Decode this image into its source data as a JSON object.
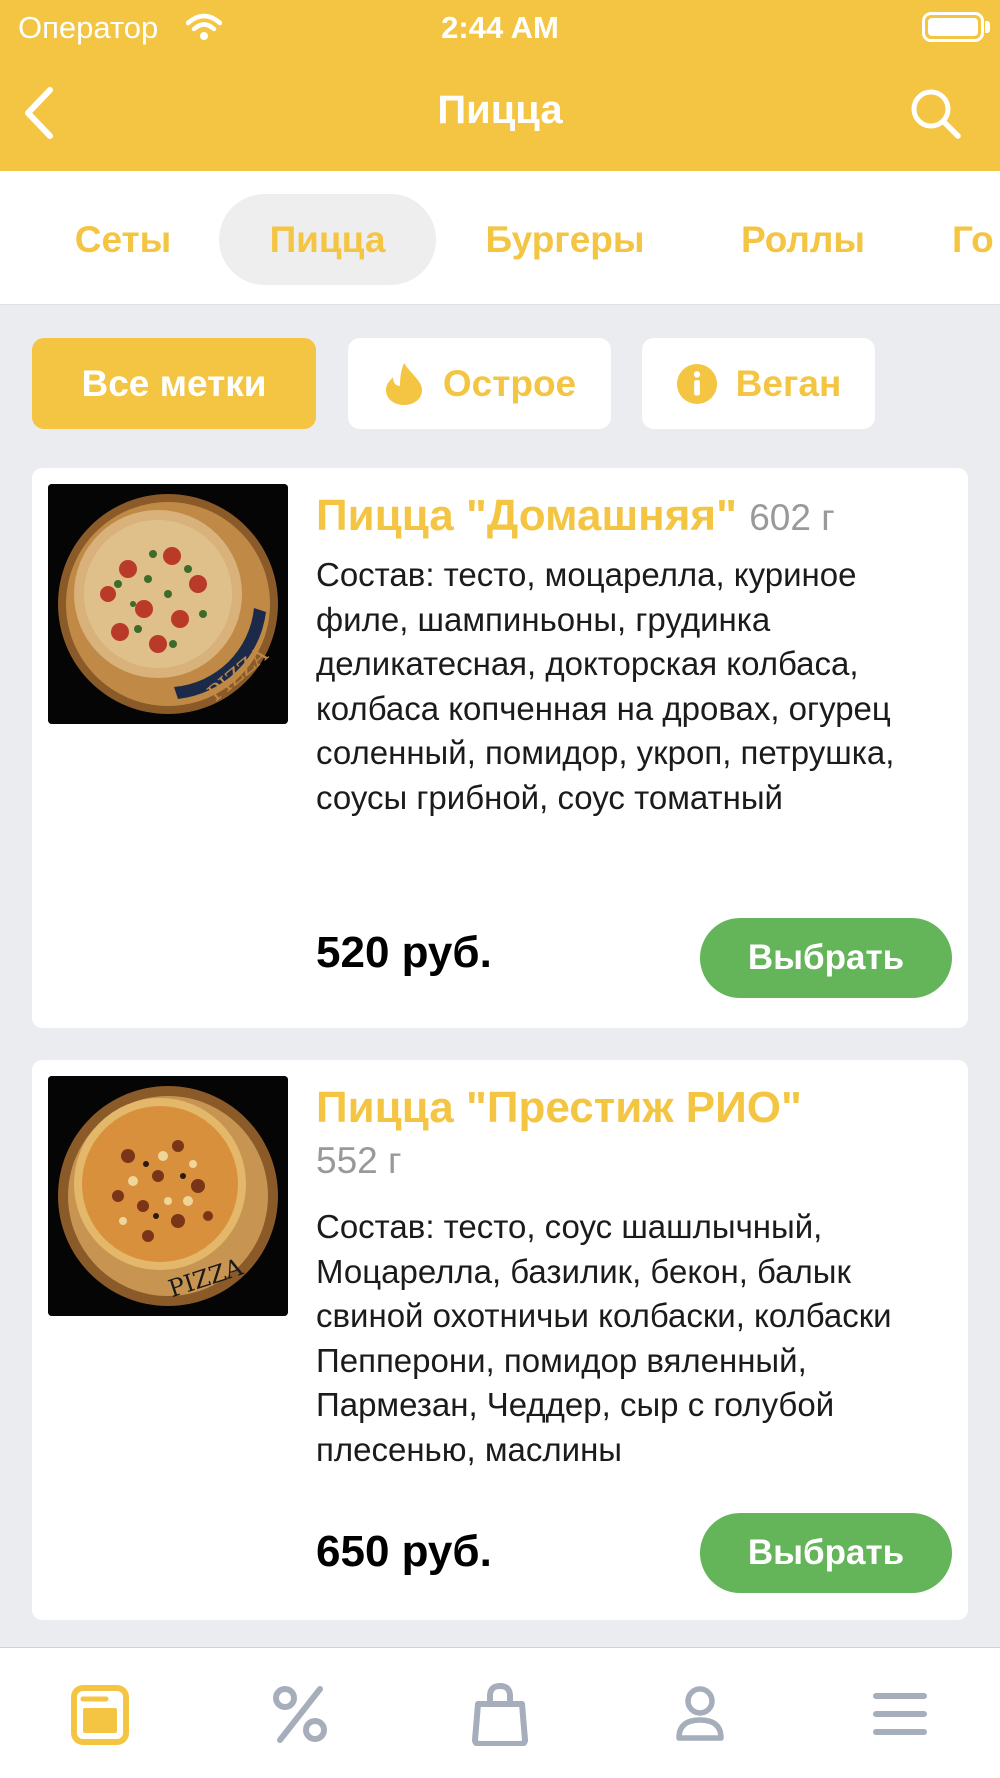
{
  "status_bar": {
    "carrier": "Оператор",
    "time": "2:44 AM"
  },
  "nav": {
    "title": "Пицца"
  },
  "categories": [
    {
      "label": "Сеты",
      "active": false
    },
    {
      "label": "Пицца",
      "active": true
    },
    {
      "label": "Бургеры",
      "active": false
    },
    {
      "label": "Роллы",
      "active": false
    },
    {
      "label": "Го",
      "active": false
    }
  ],
  "filters": [
    {
      "label": "Все метки",
      "active": true,
      "icon": ""
    },
    {
      "label": "Острое",
      "active": false,
      "icon": "flame-icon"
    },
    {
      "label": "Веган",
      "active": false,
      "icon": "info-icon"
    }
  ],
  "products": [
    {
      "title": "Пицца \"Домашняя\"",
      "weight": "602 г",
      "description": "Состав: тесто, моцарелла, куриное филе, шампиньоны, грудинка деликатесная, докторская колбаса, колбаса копченная на дровах, огурец соленный, помидор, укроп, петрушка, соусы грибной, соус томатный",
      "price": "520 руб.",
      "button": "Выбрать"
    },
    {
      "title": "Пицца \"Престиж РИО\"",
      "weight": "552 г",
      "description": "Состав: тесто, соус шашлычный, Моцарелла, базилик, бекон, балык свиной охотничьи колбаски, колбаски Пепперони, помидор вяленный, Пармезан, Чеддер, сыр с голубой плесенью, маслины",
      "price": "650 руб.",
      "button": "Выбрать"
    }
  ],
  "tabbar": [
    {
      "icon": "menu-book-icon",
      "active": true
    },
    {
      "icon": "percent-icon",
      "active": false
    },
    {
      "icon": "shopping-bag-icon",
      "active": false
    },
    {
      "icon": "profile-icon",
      "active": false
    },
    {
      "icon": "hamburger-menu-icon",
      "active": false
    }
  ],
  "colors": {
    "accent": "#f4c542",
    "button": "#64b45a",
    "inactive_icon": "#a6adbb"
  }
}
